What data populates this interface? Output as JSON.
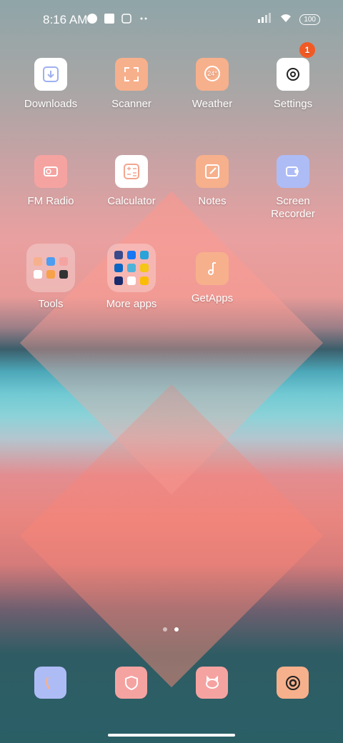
{
  "status_bar": {
    "time": "8:16 AM",
    "battery": "100"
  },
  "row1": {
    "downloads": "Downloads",
    "scanner": "Scanner",
    "weather": "Weather",
    "weather_tile_text": "24°",
    "settings": "Settings",
    "settings_badge": "1"
  },
  "row2": {
    "fm_radio": "FM Radio",
    "calculator": "Calculator",
    "notes": "Notes",
    "screen_recorder": "Screen\nRecorder"
  },
  "row3": {
    "tools": "Tools",
    "more_apps": "More apps",
    "getapps": "GetApps"
  },
  "page_indicator": {
    "current": 2,
    "total": 2
  },
  "colors": {
    "tile_peach": "#f7b08c",
    "tile_pink": "#f5a3a1",
    "tile_lavender": "#aebcf6",
    "tile_white": "#ffffff",
    "badge": "#f15a24"
  }
}
